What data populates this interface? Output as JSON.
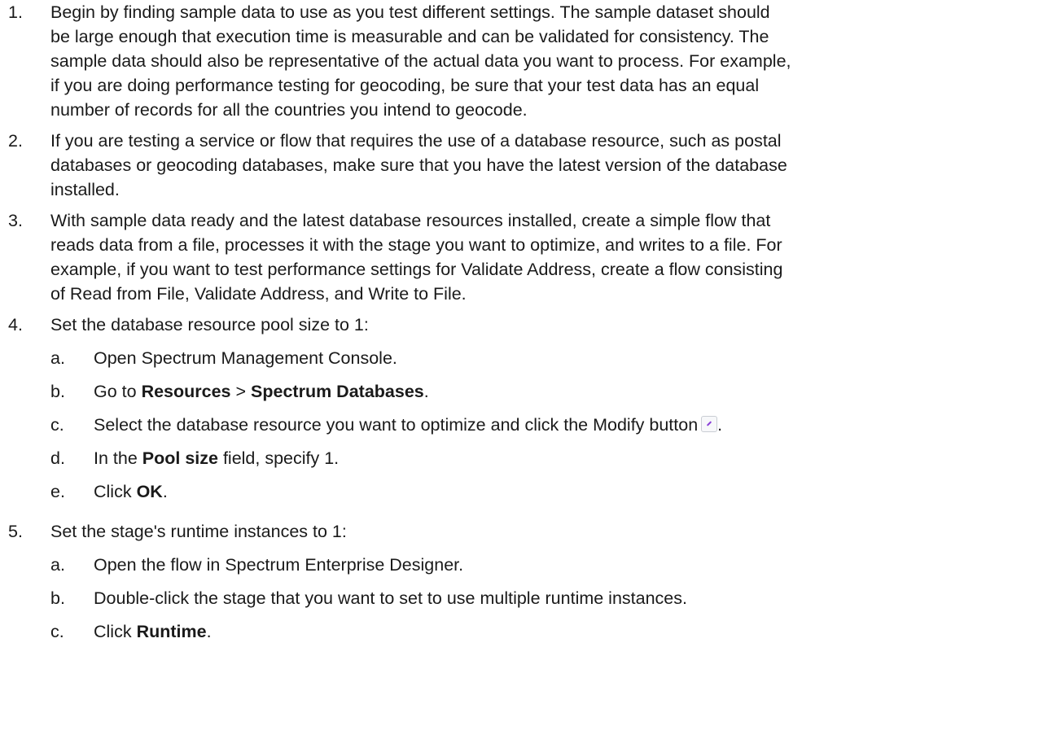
{
  "steps": [
    {
      "num": "1.",
      "lines": [
        "Begin by finding sample data to use as you test different settings. The sample dataset should",
        "be large enough that execution time is measurable and can be validated for consistency. The",
        "sample data should also be representative of the actual data you want to process. For example,",
        "if you are doing performance testing for geocoding, be sure that your test data has an equal",
        "number of records for all the countries you intend to geocode."
      ]
    },
    {
      "num": "2.",
      "lines": [
        "If you are testing a service or flow that requires the use of a database resource, such as postal",
        "databases or geocoding databases, make sure that you have the latest version of the database",
        "installed."
      ]
    },
    {
      "num": "3.",
      "lines": [
        "With sample data ready and the latest database resources installed, create a simple flow that",
        "reads data from a file, processes it with the stage you want to optimize, and writes to a file. For",
        "example, if you want to test performance settings for Validate Address, create a flow consisting",
        "of Read from File, Validate Address, and Write to File."
      ]
    },
    {
      "num": "4.",
      "text": "Set the database resource pool size to 1:",
      "sub": {
        "a": {
          "let": "a.",
          "text": "Open Spectrum Management Console."
        },
        "b": {
          "let": "b.",
          "pre": "Go to ",
          "bold1": "Resources",
          "mid": " > ",
          "bold2": "Spectrum Databases",
          "post": "."
        },
        "c": {
          "let": "c.",
          "text": "Select the database resource you want to optimize and click the Modify button",
          "post": "."
        },
        "d": {
          "let": "d.",
          "pre": "In the ",
          "bold": "Pool size",
          "post": " field, specify 1."
        },
        "e": {
          "let": "e.",
          "pre": "Click ",
          "bold": "OK",
          "post": "."
        }
      }
    },
    {
      "num": "5.",
      "text": "Set the stage's runtime instances to 1:",
      "sub": {
        "a": {
          "let": "a.",
          "text": "Open the flow in Spectrum Enterprise Designer."
        },
        "b": {
          "let": "b.",
          "text": "Double-click the stage that you want to set to use multiple runtime instances."
        },
        "c": {
          "let": "c.",
          "pre": "Click ",
          "bold": "Runtime",
          "post": "."
        }
      }
    }
  ],
  "icons": {
    "modify": "pencil-edit-icon"
  }
}
